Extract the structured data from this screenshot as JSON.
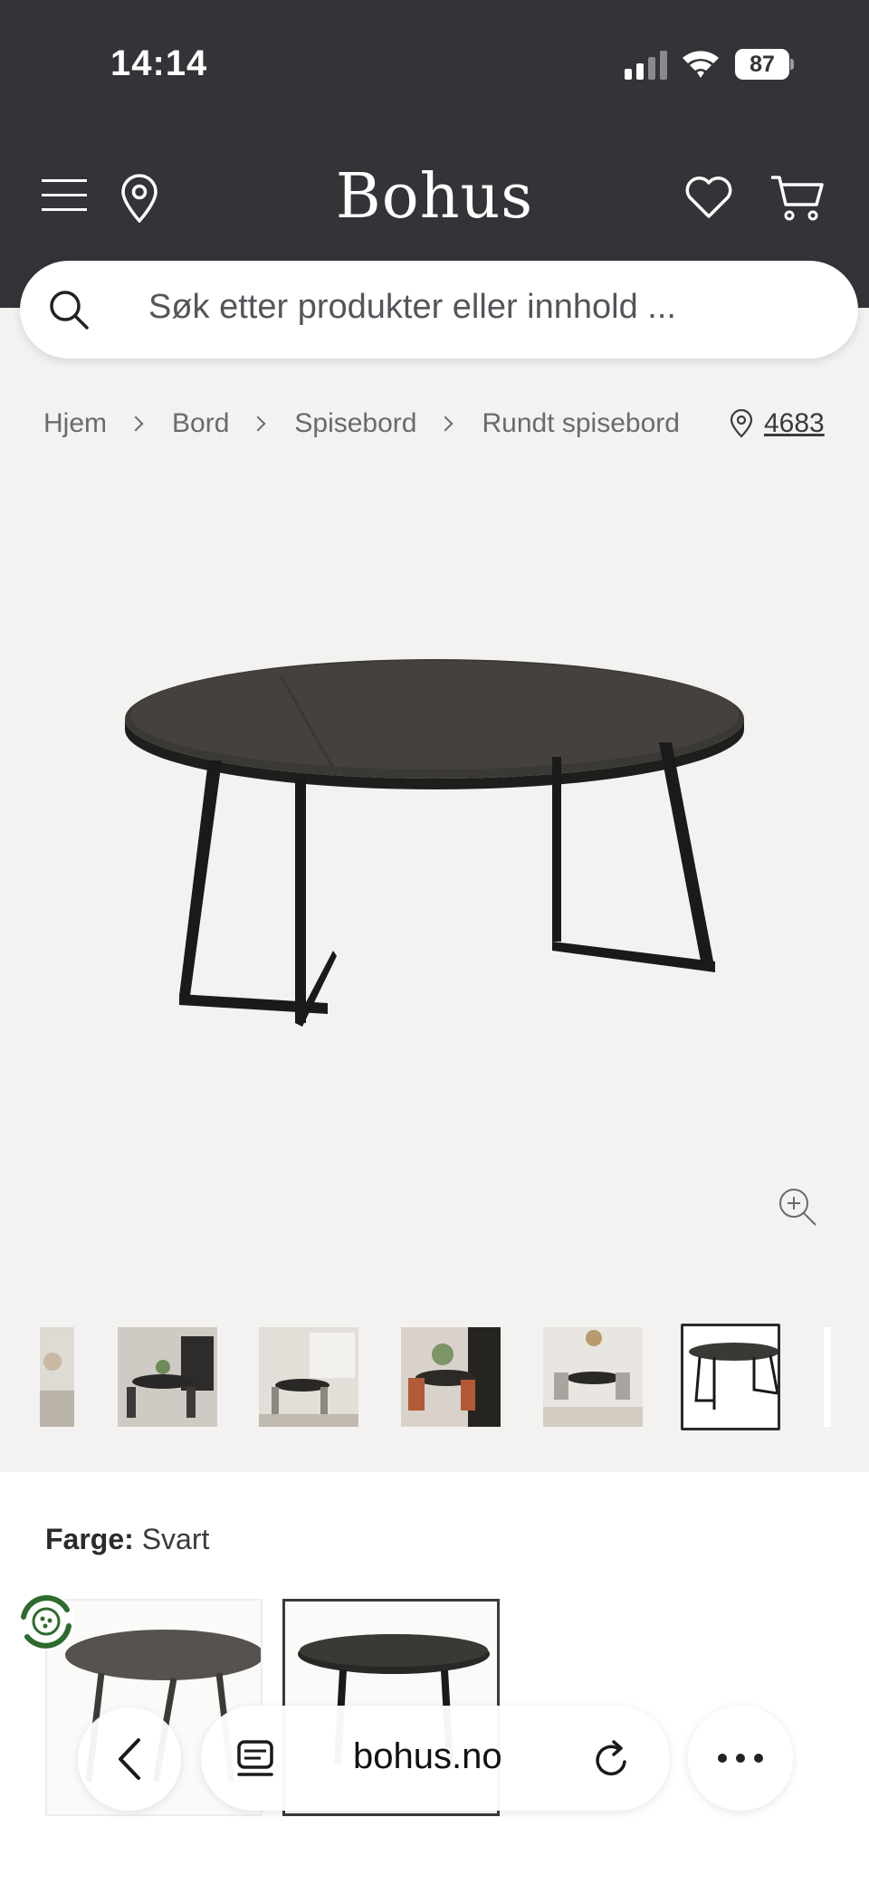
{
  "status_bar": {
    "time": "14:14",
    "battery": "87"
  },
  "header": {
    "brand": "Bohus",
    "icons": [
      "menu-icon",
      "location-pin-icon",
      "heart-icon",
      "cart-icon"
    ]
  },
  "search": {
    "placeholder": "Søk etter produkter eller innhold ..."
  },
  "breadcrumb": {
    "items": [
      "Hjem",
      "Bord",
      "Spisebord",
      "Rundt spisebord"
    ],
    "store_number": "4683"
  },
  "product": {
    "color_label": "Farge:",
    "color_value": "Svart"
  },
  "browser": {
    "url": "bohus.no"
  },
  "colors": {
    "header_bg": "#343338",
    "page_bg": "#f4f2f0",
    "accent_green": "#2e6b2e"
  }
}
